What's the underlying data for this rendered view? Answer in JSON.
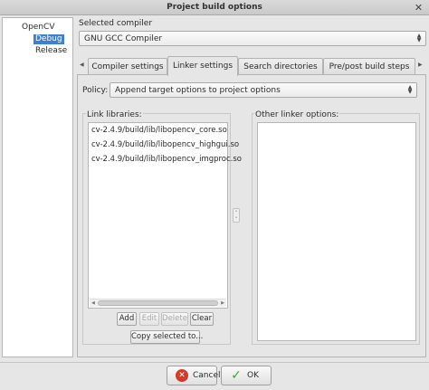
{
  "window": {
    "title": "Project build options"
  },
  "tree": {
    "root": "OpenCV",
    "items": [
      "Debug",
      "Release"
    ],
    "selected": "Debug"
  },
  "compiler": {
    "label": "Selected compiler",
    "value": "GNU GCC Compiler"
  },
  "tabs": [
    {
      "label": "Compiler settings",
      "active": false
    },
    {
      "label": "Linker settings",
      "active": true
    },
    {
      "label": "Search directories",
      "active": false
    },
    {
      "label": "Pre/post build steps",
      "active": false
    }
  ],
  "policy": {
    "label": "Policy:",
    "value": "Append target options to project options"
  },
  "link_libraries": {
    "label": "Link libraries:",
    "items": [
      "cv-2.4.9/build/lib/libopencv_core.so",
      "cv-2.4.9/build/lib/libopencv_highgui.so",
      "cv-2.4.9/build/lib/libopencv_imgproc.so"
    ]
  },
  "other_linker": {
    "label": "Other linker options:"
  },
  "lib_buttons": {
    "add": "Add",
    "edit": "Edit",
    "delete": "Delete",
    "clear": "Clear",
    "copy": "Copy selected to..."
  },
  "dialog_buttons": {
    "cancel": "Cancel",
    "ok": "OK"
  },
  "colors": {
    "selection": "#3d7fd1",
    "cancel_icon": "#d23a2a",
    "ok_icon": "#3aa33a"
  }
}
